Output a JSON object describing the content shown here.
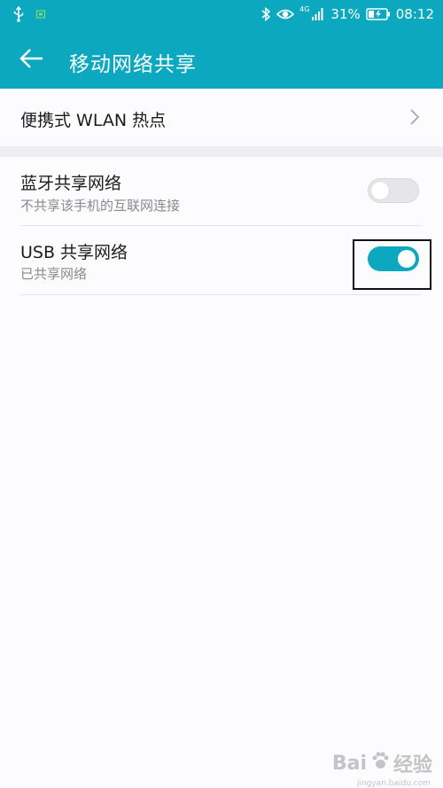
{
  "status_bar": {
    "network_label": "4G",
    "battery": "31%",
    "time": "08:12"
  },
  "app_bar": {
    "title": "移动网络共享"
  },
  "rows": {
    "hotspot": {
      "title": "便携式 WLAN 热点"
    },
    "bluetooth": {
      "title": "蓝牙共享网络",
      "subtitle": "不共享该手机的互联网连接",
      "enabled": false
    },
    "usb": {
      "title": "USB 共享网络",
      "subtitle": "已共享网络",
      "enabled": true
    }
  },
  "watermark": {
    "brand": "Bai",
    "suffix": "经验",
    "url": "jingyan.baidu.com"
  },
  "colors": {
    "accent": "#0ba8c0",
    "highlight_border": "#111111"
  },
  "icons": [
    "usb-icon",
    "sim-icon",
    "bluetooth-icon",
    "eye-icon",
    "signal-icon",
    "battery-charging-icon",
    "back-arrow-icon",
    "chevron-right-icon",
    "baidu-paw-icon"
  ]
}
